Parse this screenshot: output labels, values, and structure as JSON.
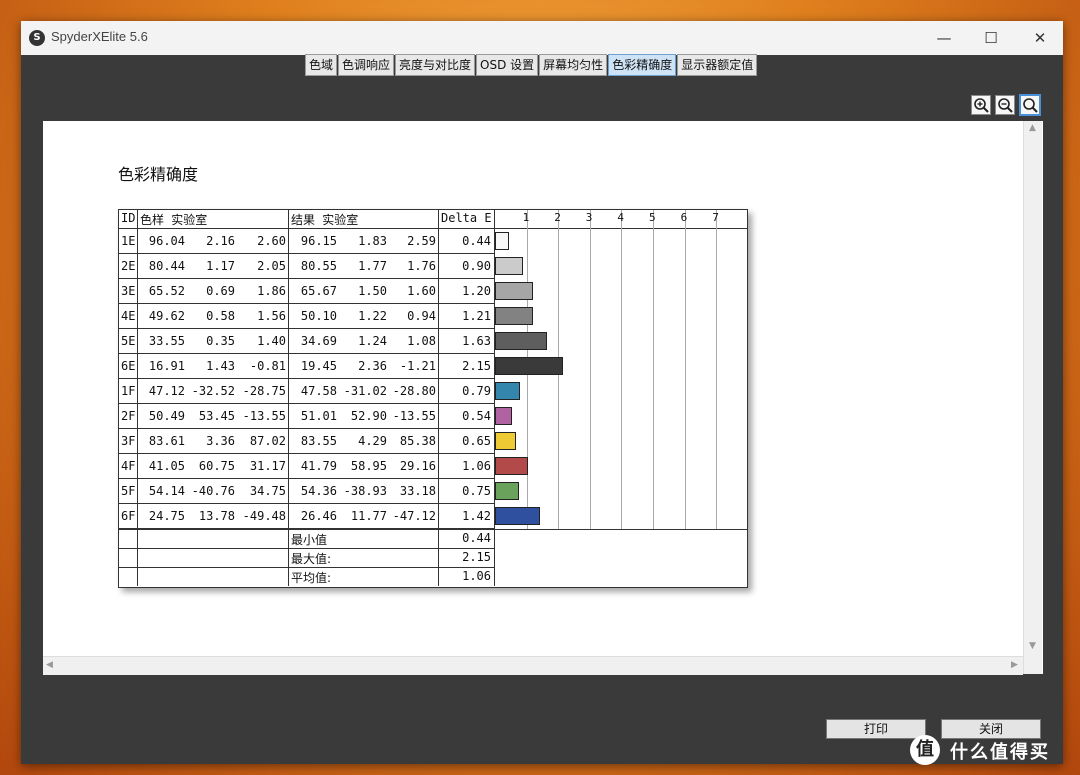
{
  "window": {
    "title": "SpyderXElite 5.6",
    "app_icon": "S"
  },
  "tabs": [
    {
      "label": "色域",
      "active": false
    },
    {
      "label": "色调响应",
      "active": false
    },
    {
      "label": "亮度与对比度",
      "active": false
    },
    {
      "label": "OSD 设置",
      "active": false
    },
    {
      "label": "屏幕均匀性",
      "active": false
    },
    {
      "label": "色彩精确度",
      "active": true
    },
    {
      "label": "显示器额定值",
      "active": false
    }
  ],
  "zoom_tools": [
    "zoom-in-icon",
    "zoom-out-icon",
    "zoom-fit-icon"
  ],
  "report": {
    "title": "色彩精确度",
    "headers": {
      "id": "ID",
      "sample": "色样 实验室",
      "result": "结果 实验室",
      "delta": "Delta E"
    },
    "scale_ticks": [
      "1",
      "2",
      "3",
      "4",
      "5",
      "6",
      "7"
    ],
    "rows": [
      {
        "id": "1E",
        "s1": "96.04",
        "s2": "2.16",
        "s3": "2.60",
        "r1": "96.15",
        "r2": "1.83",
        "r3": "2.59",
        "de": "0.44",
        "color": "#f7f7f7"
      },
      {
        "id": "2E",
        "s1": "80.44",
        "s2": "1.17",
        "s3": "2.05",
        "r1": "80.55",
        "r2": "1.77",
        "r3": "1.76",
        "de": "0.90",
        "color": "#cbcbcb"
      },
      {
        "id": "3E",
        "s1": "65.52",
        "s2": "0.69",
        "s3": "1.86",
        "r1": "65.67",
        "r2": "1.50",
        "r3": "1.60",
        "de": "1.20",
        "color": "#a6a6a6"
      },
      {
        "id": "4E",
        "s1": "49.62",
        "s2": "0.58",
        "s3": "1.56",
        "r1": "50.10",
        "r2": "1.22",
        "r3": "0.94",
        "de": "1.21",
        "color": "#828282"
      },
      {
        "id": "5E",
        "s1": "33.55",
        "s2": "0.35",
        "s3": "1.40",
        "r1": "34.69",
        "r2": "1.24",
        "r3": "1.08",
        "de": "1.63",
        "color": "#5e5e5e"
      },
      {
        "id": "6E",
        "s1": "16.91",
        "s2": "1.43",
        "s3": "-0.81",
        "r1": "19.45",
        "r2": "2.36",
        "r3": "-1.21",
        "de": "2.15",
        "color": "#3a3a3a"
      },
      {
        "id": "1F",
        "s1": "47.12",
        "s2": "-32.52",
        "s3": "-28.75",
        "r1": "47.58",
        "r2": "-31.02",
        "r3": "-28.80",
        "de": "0.79",
        "color": "#3486ad"
      },
      {
        "id": "2F",
        "s1": "50.49",
        "s2": "53.45",
        "s3": "-13.55",
        "r1": "51.01",
        "r2": "52.90",
        "r3": "-13.55",
        "de": "0.54",
        "color": "#b162a3"
      },
      {
        "id": "3F",
        "s1": "83.61",
        "s2": "3.36",
        "s3": "87.02",
        "r1": "83.55",
        "r2": "4.29",
        "r3": "85.38",
        "de": "0.65",
        "color": "#eecb35"
      },
      {
        "id": "4F",
        "s1": "41.05",
        "s2": "60.75",
        "s3": "31.17",
        "r1": "41.79",
        "r2": "58.95",
        "r3": "29.16",
        "de": "1.06",
        "color": "#b34a4a"
      },
      {
        "id": "5F",
        "s1": "54.14",
        "s2": "-40.76",
        "s3": "34.75",
        "r1": "54.36",
        "r2": "-38.93",
        "r3": "33.18",
        "de": "0.75",
        "color": "#6aa15b"
      },
      {
        "id": "6F",
        "s1": "24.75",
        "s2": "13.78",
        "s3": "-49.48",
        "r1": "26.46",
        "r2": "11.77",
        "r3": "-47.12",
        "de": "1.42",
        "color": "#2f4f9f"
      }
    ],
    "summary": [
      {
        "label": "最小值",
        "value": "0.44"
      },
      {
        "label": "最大值:",
        "value": "2.15"
      },
      {
        "label": "平均值:",
        "value": "1.06"
      }
    ]
  },
  "buttons": {
    "print": "打印",
    "close": "关闭"
  },
  "watermark": {
    "badge": "值",
    "text": "什么值得买"
  }
}
